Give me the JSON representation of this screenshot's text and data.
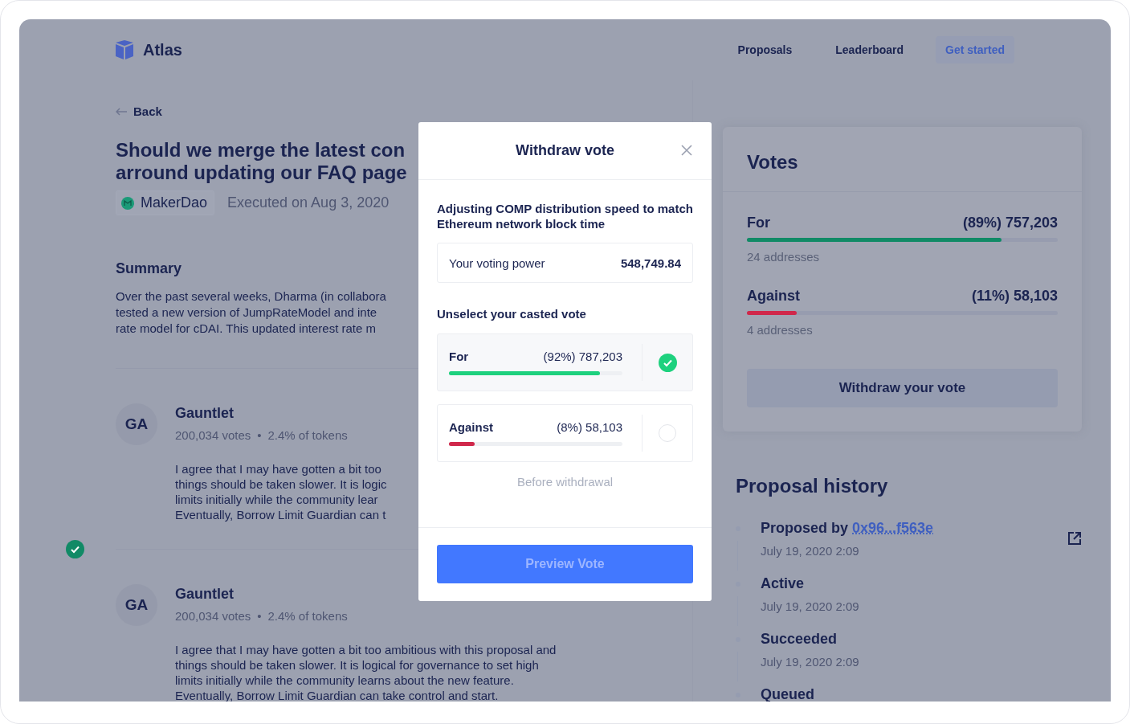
{
  "brand": {
    "name": "Atlas"
  },
  "nav": [
    {
      "label": "Proposals",
      "kind": "link"
    },
    {
      "label": "Leaderboard",
      "kind": "link"
    },
    {
      "label": "Get started",
      "kind": "button"
    }
  ],
  "back": "Back",
  "proposal": {
    "title_lines": [
      "Should we merge the latest con",
      "arround updating our FAQ page"
    ],
    "org": "MakerDao",
    "status": "Executed on Aug 3, 2020",
    "summary_heading": "Summary",
    "summary_lines": [
      "Over the past several weeks, Dharma (in collabora",
      "tested a new version of JumpRateModel and inte",
      "rate model for cDAI. This updated interest rate m"
    ]
  },
  "comments": [
    {
      "initials": "GA",
      "name": "Gauntlet",
      "votes": "200,034 votes",
      "separator": "•",
      "share": "2.4% of tokens",
      "checked": false,
      "lines": [
        "I agree that I may have gotten a bit too",
        "things should be taken slower. It is logic",
        "limits initially while the community lear",
        "Eventually, Borrow Limit Guardian can t"
      ]
    },
    {
      "initials": "GA",
      "name": "Gauntlet",
      "votes": "200,034 votes",
      "separator": "•",
      "share": "2.4% of tokens",
      "checked": true,
      "lines": [
        "I agree that I may have gotten a bit too ambitious with this proposal and",
        "things should be taken slower. It is logical for governance to set high",
        "limits initially while the community learns about the new feature.",
        "Eventually, Borrow Limit Guardian can take control and start."
      ]
    }
  ],
  "votes_card": {
    "title": "Votes",
    "options": [
      {
        "label": "For",
        "reading": "(89%) 757,203",
        "level": 0.82,
        "color": "#118a66",
        "addresses": "24 addresses"
      },
      {
        "label": "Against",
        "reading": "(11%) 58,103",
        "level": 0.16,
        "color": "#d0284b",
        "addresses": "4 addresses"
      }
    ],
    "button": "Withdraw your vote"
  },
  "history": {
    "title": "Proposal history",
    "events": [
      {
        "label": "Proposed by",
        "link": "0x96...f563e",
        "date": "July 19, 2020 2:09"
      },
      {
        "label": "Active",
        "date": "July 19, 2020 2:09"
      },
      {
        "label": "Succeeded",
        "date": "July 19, 2020 2:09"
      },
      {
        "label": "Queued"
      }
    ]
  },
  "modal": {
    "title": "Withdraw vote",
    "proposal": "Adjusting COMP distribution speed to match Ethereum network block time",
    "power_label": "Your voting power",
    "power_value": "548,749.84",
    "prompt": "Unselect your casted vote",
    "options": [
      {
        "label": "For",
        "reading": "(92%) 787,203",
        "level": 0.87,
        "color": "#1ed17e",
        "selected": true
      },
      {
        "label": "Against",
        "reading": "(8%) 58,103",
        "level": 0.15,
        "color": "#d0284b",
        "selected": false
      }
    ],
    "note": "Before withdrawal",
    "button": "Preview Vote",
    "button_disabled": true
  }
}
